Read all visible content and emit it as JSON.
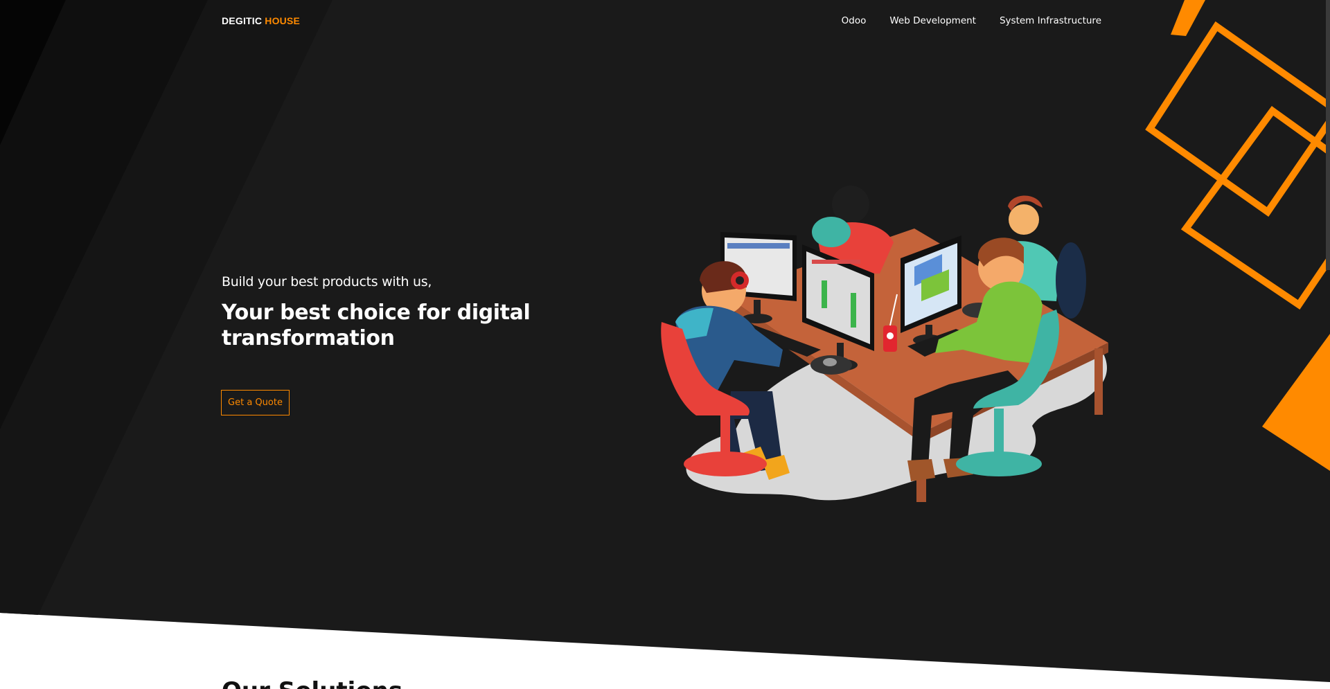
{
  "brand": {
    "name_white": "DEGITIC",
    "name_orange": "HOUSE"
  },
  "nav": {
    "items": [
      {
        "label": "Odoo"
      },
      {
        "label": "Web Development"
      },
      {
        "label": "System Infrastructure"
      }
    ]
  },
  "hero": {
    "tagline": "Build your best products with us,",
    "headline": "Your best choice for digital transformation",
    "cta": "Get a Quote"
  },
  "next_section": {
    "title": "Our Solutions"
  },
  "colors": {
    "accent": "#ff8a00",
    "dark": "#1a1a1a",
    "darker": "#070707"
  }
}
